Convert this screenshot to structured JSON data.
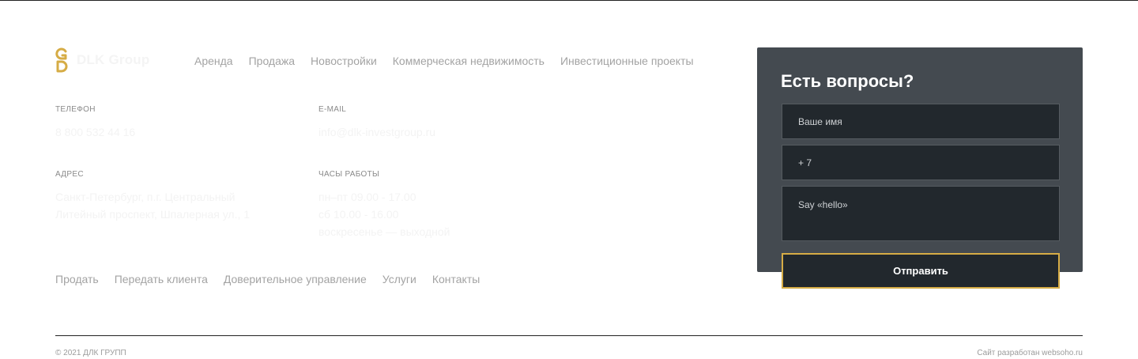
{
  "brand": {
    "name": "DLK Group",
    "accent_color": "#d6ac45"
  },
  "top_nav": [
    "Аренда",
    "Продажа",
    "Новостройки",
    "Коммерческая недвижимость",
    "Инвестиционные проекты"
  ],
  "contacts": {
    "phone_label": "ТЕЛЕФОН",
    "phone_value": "8 800 532 44 16",
    "email_label": "E-MAIL",
    "email_value": "info@dlk-investgroup.ru",
    "address_label": "АДРЕС",
    "address_lines": [
      "Санкт-Петербург, п.г. Центральный",
      "Литейный проспект, Шпалерная ул., 1"
    ],
    "hours_label": "ЧАСЫ РАБОТЫ",
    "hours_lines": [
      "пн–пт 09.00 - 17.00",
      "сб 10.00 - 16.00",
      "воскресенье — выходной"
    ]
  },
  "bottom_nav": [
    "Продать",
    "Передать клиента",
    "Доверительное управление",
    "Услуги",
    "Контакты"
  ],
  "footer": {
    "copyright": "© 2021 ДЛК ГРУПП",
    "developer": "Сайт разработан websoho.ru"
  },
  "contact_form": {
    "title": "Есть вопросы?",
    "name_placeholder": "Ваше имя",
    "phone_value": "+ 7",
    "message_placeholder": "Say «hello»",
    "submit_label": "Отправить",
    "card_color": "#444a50",
    "field_color": "#22282d"
  }
}
